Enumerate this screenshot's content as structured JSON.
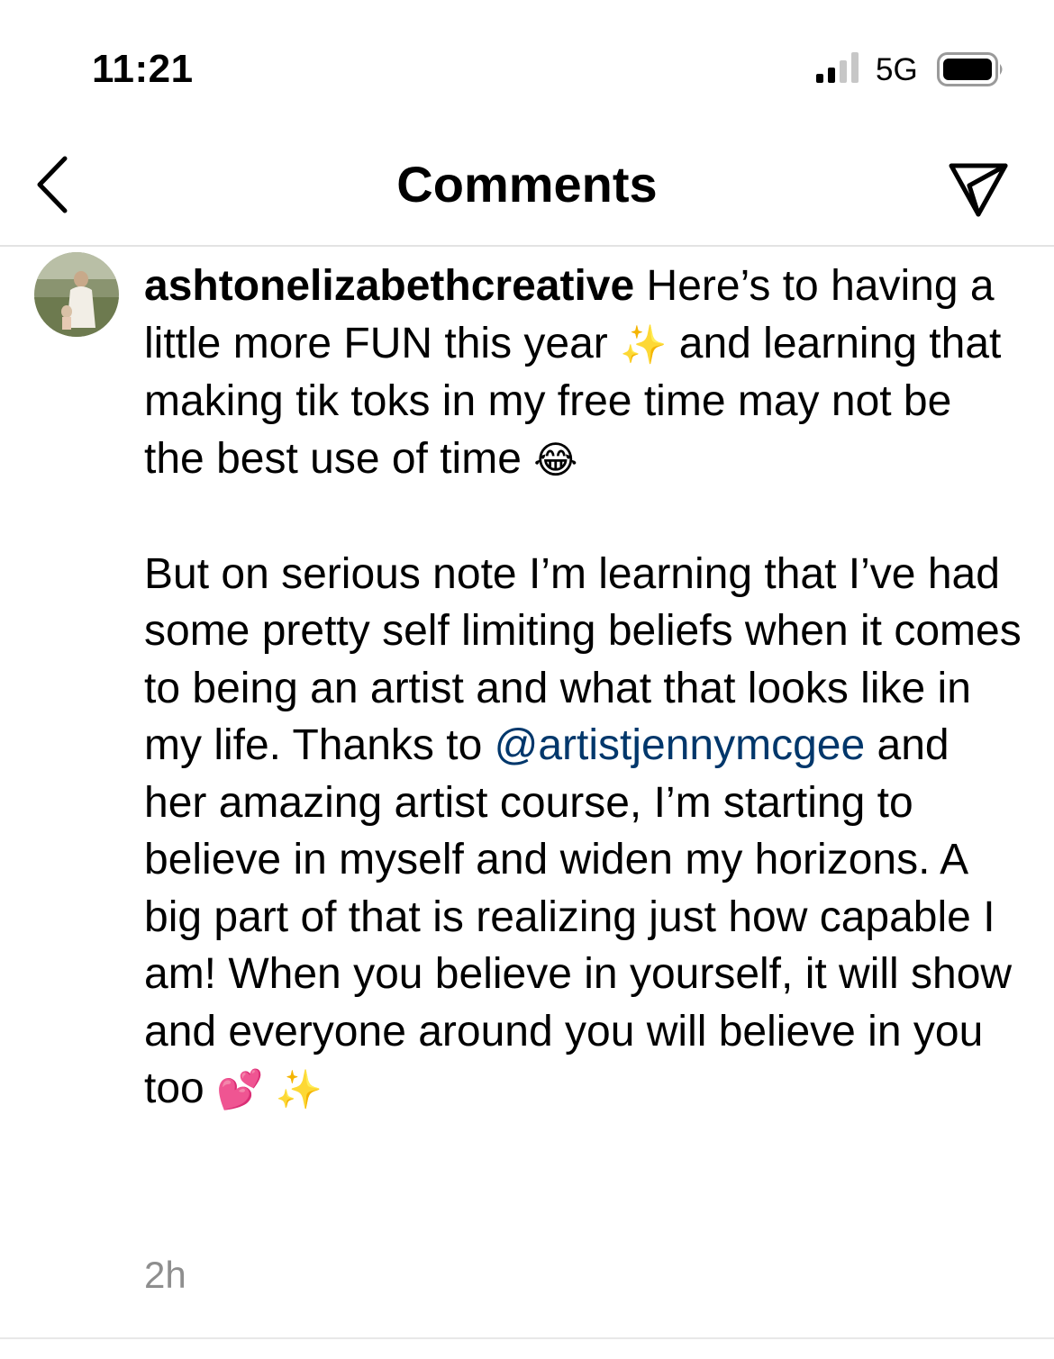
{
  "status_bar": {
    "time": "11:21",
    "network": "5G"
  },
  "header": {
    "title": "Comments"
  },
  "comment": {
    "username": "ashtonelizabethcreative",
    "text_before_mention": " Here’s to having a little more FUN this year ",
    "emoji_sparkles_1": "✨",
    "text_2": " and learning that making tik toks in my free time may not be the best use of time ",
    "emoji_laugh": "😂",
    "text_3": "\n\nBut on serious note I’m learning that I’ve had some pretty self limiting beliefs when it comes to being an artist and what that looks like in my life. Thanks to ",
    "mention": "@artistjennymcgee",
    "text_4": " and her amazing artist course, I’m starting to believe in myself and widen my horizons. A big part of that is realizing just how capable I am! When you believe in yourself, it will show and everyone around you will believe in you too ",
    "emoji_hearts": "💕",
    "emoji_sparkles_2": " ✨",
    "time_ago": "2h"
  },
  "colors": {
    "mention": "#00376b",
    "meta_text": "#8e8e8e",
    "divider": "#e3e3e3"
  },
  "icons": [
    "signal-icon",
    "battery-icon",
    "back-chevron-icon",
    "share-paper-plane-icon",
    "avatar"
  ]
}
